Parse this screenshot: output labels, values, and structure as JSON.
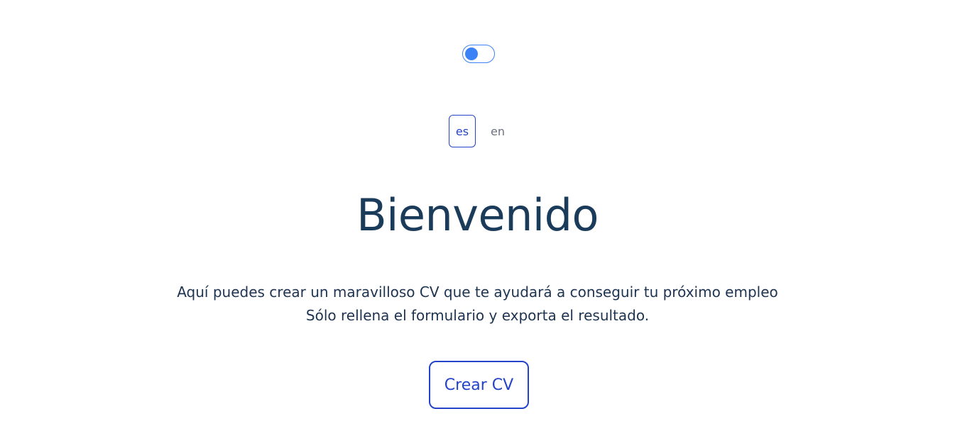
{
  "theme_toggle": {
    "state": "off",
    "accent_color": "#3b82f6"
  },
  "language": {
    "options": [
      "es",
      "en"
    ],
    "selected": "es"
  },
  "hero": {
    "title": "Bienvenido",
    "description_line_1": "Aquí puedes crear un maravilloso CV que te ayudará a conseguir tu próximo empleo",
    "description_line_2": "Sólo rellena el formulario y exporta el resultado."
  },
  "actions": {
    "create_cv_label": "Crear CV"
  },
  "colors": {
    "primary": "#2543c9",
    "title": "#1b3b5a",
    "text": "#1e3350",
    "muted": "#6b7280"
  }
}
